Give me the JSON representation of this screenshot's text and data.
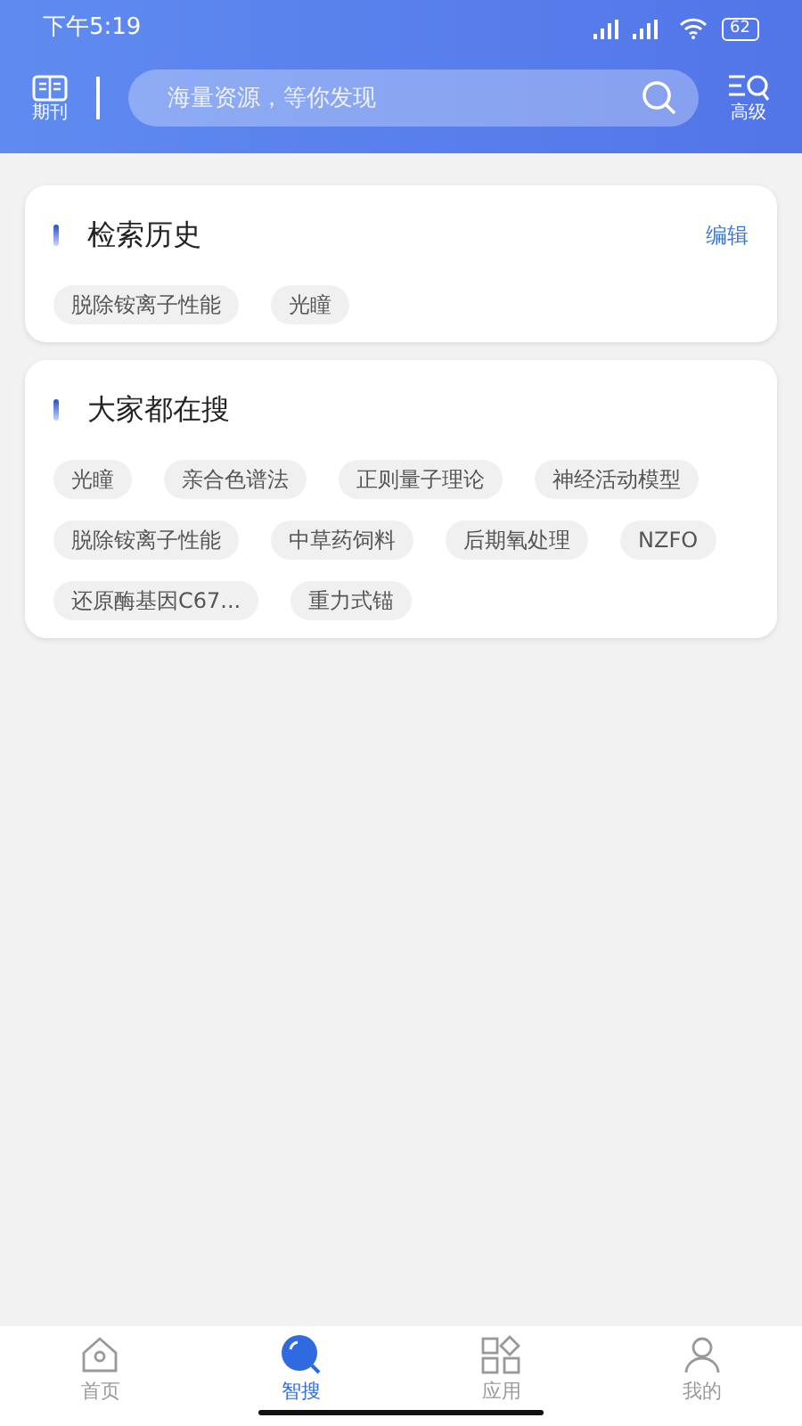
{
  "status_bar": {
    "time": "下午5:19",
    "battery": "62"
  },
  "header": {
    "left_label": "期刊",
    "search": {
      "placeholder": "海量资源，等你发现"
    },
    "right_label": "高级"
  },
  "sections": [
    {
      "title": "检索历史",
      "action": "编辑",
      "tags": [
        "脱除铵离子性能",
        "光瞳"
      ]
    },
    {
      "title": "大家都在搜",
      "tags": [
        "光瞳",
        "亲合色谱法",
        "正则量子理论",
        "神经活动模型",
        "脱除铵离子性能",
        "中草药饲料",
        "后期氧处理",
        "NZFO",
        "还原酶基因C67...",
        "重力式锚"
      ]
    }
  ],
  "tab_bar": [
    {
      "kind": "home",
      "label": "首页",
      "selected": false
    },
    {
      "kind": "search",
      "label": "智搜",
      "selected": true
    },
    {
      "kind": "apps",
      "label": "应用",
      "selected": false
    },
    {
      "kind": "profile",
      "label": "我的",
      "selected": false
    }
  ]
}
